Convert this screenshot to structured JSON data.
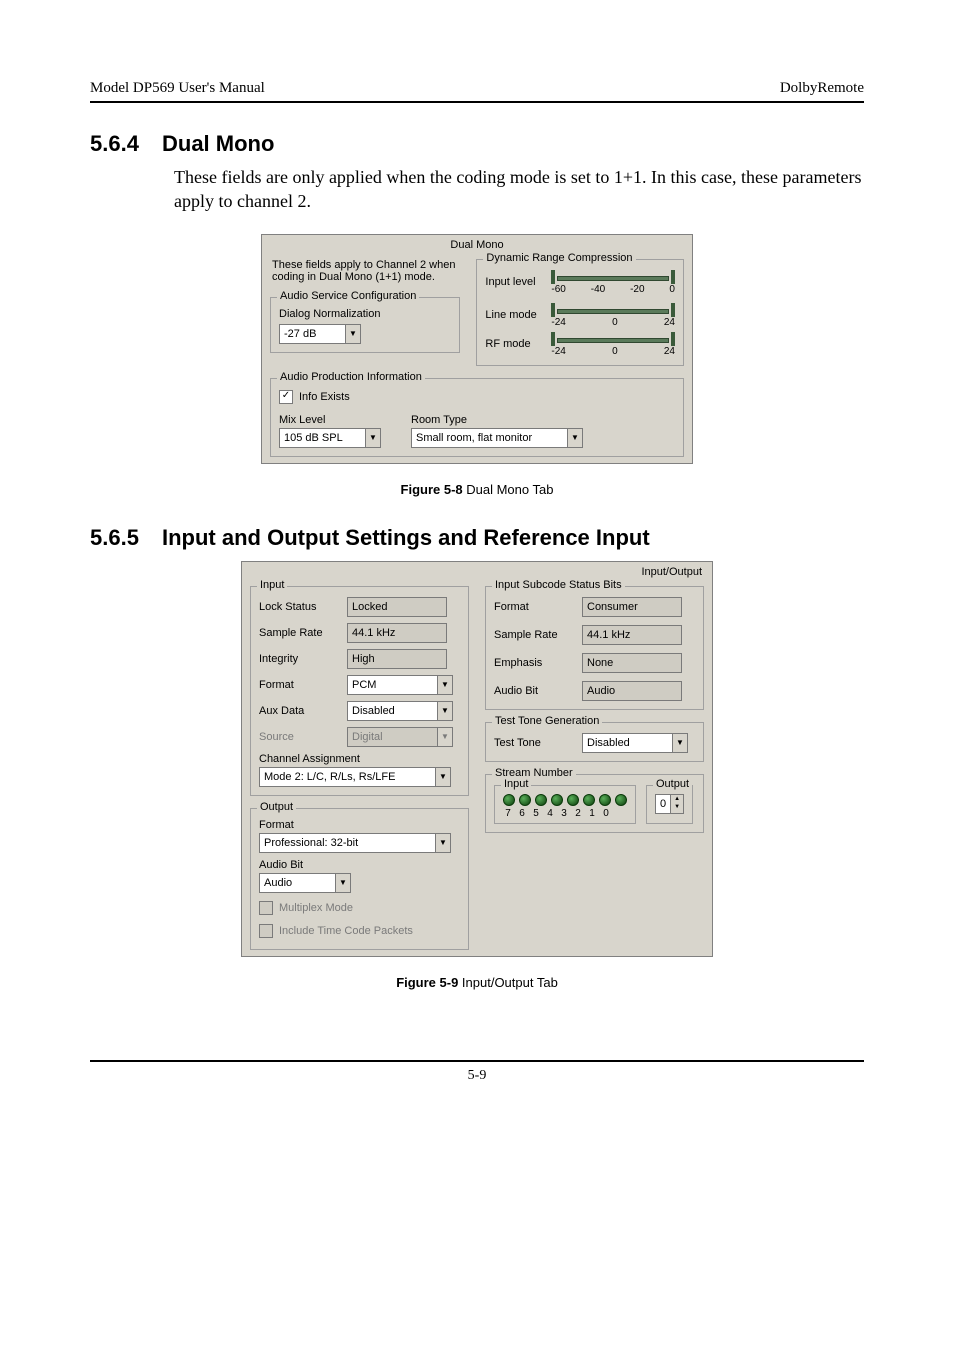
{
  "header": {
    "left": "Model DP569 User's Manual",
    "right": "DolbyRemote"
  },
  "sec1": {
    "num": "5.6.4",
    "title": "Dual Mono",
    "body": "These fields are only applied when the coding mode is set to 1+1. In this case, these parameters apply to channel 2."
  },
  "fig1": {
    "title": "Dual Mono",
    "note": "These fields apply to Channel 2 when coding in Dual Mono (1+1) mode.",
    "drc": {
      "legend": "Dynamic Range Compression",
      "input_label": "Input level",
      "input_scale": [
        "-60",
        "-40",
        "-20",
        "0"
      ],
      "line_label": "Line mode",
      "line_scale": [
        "-24",
        "0",
        "24"
      ],
      "rf_label": "RF mode",
      "rf_scale": [
        "-24",
        "0",
        "24"
      ]
    },
    "asc": {
      "legend": "Audio Service Configuration",
      "dn_label": "Dialog Normalization",
      "dn_value": "-27 dB"
    },
    "api": {
      "legend": "Audio Production Information",
      "info_exists": "Info Exists",
      "mix_label": "Mix Level",
      "mix_value": "105 dB SPL",
      "room_label": "Room Type",
      "room_value": "Small room, flat monitor"
    },
    "caption_b": "Figure 5-8",
    "caption_t": " Dual Mono Tab"
  },
  "sec2": {
    "num": "5.6.5",
    "title": "Input and Output Settings and Reference Input"
  },
  "fig2": {
    "title": "Input/Output",
    "input": {
      "legend": "Input",
      "lock_label": "Lock Status",
      "lock_value": "Locked",
      "rate_label": "Sample Rate",
      "rate_value": "44.1 kHz",
      "int_label": "Integrity",
      "int_value": "High",
      "fmt_label": "Format",
      "fmt_value": "PCM",
      "aux_label": "Aux Data",
      "aux_value": "Disabled",
      "src_label": "Source",
      "src_value": "Digital",
      "ch_label": "Channel Assignment",
      "ch_value": "Mode 2: L/C, R/Ls, Rs/LFE"
    },
    "output": {
      "legend": "Output",
      "fmt_label": "Format",
      "fmt_value": "Professional: 32-bit",
      "ab_label": "Audio Bit",
      "ab_value": "Audio",
      "mux": "Multiplex Mode",
      "tc": "Include Time Code Packets"
    },
    "isb": {
      "legend": "Input Subcode Status Bits",
      "fmt_label": "Format",
      "fmt_value": "Consumer",
      "rate_label": "Sample Rate",
      "rate_value": "44.1 kHz",
      "emp_label": "Emphasis",
      "emp_value": "None",
      "ab_label": "Audio Bit",
      "ab_value": "Audio"
    },
    "ttg": {
      "legend": "Test Tone Generation",
      "tt_label": "Test Tone",
      "tt_value": "Disabled"
    },
    "sn": {
      "legend": "Stream Number",
      "input_legend": "Input",
      "output_legend": "Output",
      "nums": [
        "7",
        "6",
        "5",
        "4",
        "3",
        "2",
        "1",
        "0"
      ],
      "out_val": "0"
    },
    "caption_b": "Figure 5-9",
    "caption_t": " Input/Output Tab"
  },
  "footer": {
    "page": "5-9"
  }
}
